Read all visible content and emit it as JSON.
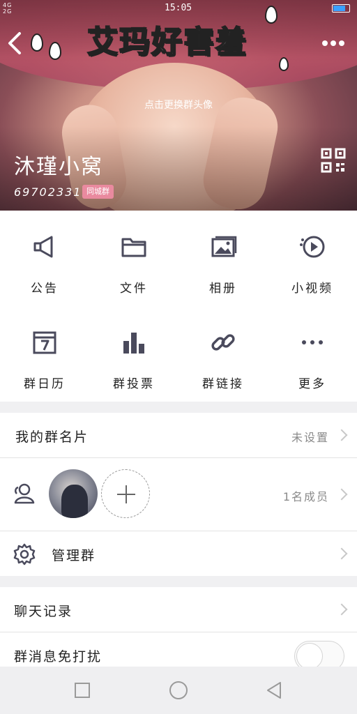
{
  "status_bar": {
    "network_1": "4G",
    "network_2": "2G",
    "time": "15:05"
  },
  "header": {
    "sticker_text": "艾玛好害羞",
    "change_avatar_hint": "点击更换群头像",
    "group_name": "沐瑾小窝",
    "group_id": "697023315",
    "group_badge": "同城群"
  },
  "grid": {
    "items": [
      {
        "label": "公告",
        "icon": "megaphone-icon"
      },
      {
        "label": "文件",
        "icon": "folder-icon"
      },
      {
        "label": "相册",
        "icon": "photo-album-icon"
      },
      {
        "label": "小视频",
        "icon": "video-icon"
      },
      {
        "label": "群日历",
        "icon": "calendar-icon"
      },
      {
        "label": "群投票",
        "icon": "bar-chart-icon"
      },
      {
        "label": "群链接",
        "icon": "link-icon"
      },
      {
        "label": "更多",
        "icon": "more-icon"
      }
    ]
  },
  "settings": {
    "group_card": {
      "label": "我的群名片",
      "value": "未设置"
    },
    "members": {
      "count": "1名成员"
    },
    "manage": {
      "label": "管理群"
    },
    "chat_history": {
      "label": "聊天记录"
    },
    "do_not_disturb": {
      "label": "群消息免打扰",
      "enabled": false
    }
  },
  "colors": {
    "accent": "#4a4a5c",
    "badge": "#e98a9f"
  }
}
